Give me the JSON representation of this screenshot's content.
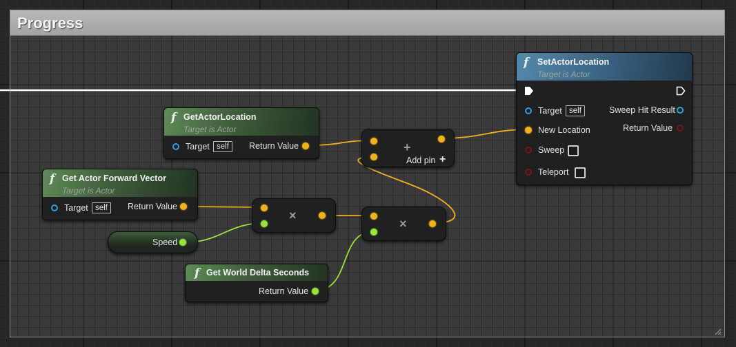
{
  "comment": {
    "title": "Progress"
  },
  "nodes": {
    "set_actor_location": {
      "title": "SetActorLocation",
      "subtitle": "Target is Actor",
      "inputs": {
        "target": "Target",
        "target_default": "self",
        "new_location": "New Location",
        "sweep": "Sweep",
        "teleport": "Teleport"
      },
      "outputs": {
        "sweep_hit_result": "Sweep Hit Result",
        "return_value": "Return Value"
      }
    },
    "get_actor_location": {
      "title": "GetActorLocation",
      "subtitle": "Target is Actor",
      "inputs": {
        "target": "Target",
        "target_default": "self"
      },
      "outputs": {
        "return_value": "Return Value"
      }
    },
    "get_actor_forward_vector": {
      "title": "Get Actor Forward Vector",
      "subtitle": "Target is Actor",
      "inputs": {
        "target": "Target",
        "target_default": "self"
      },
      "outputs": {
        "return_value": "Return Value"
      }
    },
    "speed": {
      "label": "Speed"
    },
    "get_world_delta_seconds": {
      "title": "Get World Delta Seconds",
      "outputs": {
        "return_value": "Return Value"
      }
    },
    "add_node": {
      "symbol": "+",
      "add_pin": "Add pin",
      "add_pin_symbol": "+"
    },
    "multiply_node_1": {
      "symbol": "×"
    },
    "multiply_node_2": {
      "symbol": "×"
    }
  },
  "icons": {
    "function": "f",
    "exec_pin": "exec-triangle",
    "resize": "resize-grip-icon"
  },
  "colors": {
    "vector_pin": "#f0b21e",
    "float_pin": "#97e43a",
    "object_pin": "#2f9fe2",
    "struct_pin": "#8a1212",
    "exec_wire": "#ffffff",
    "pure_header": "#4e7a4a",
    "callable_header": "#3d6787"
  }
}
